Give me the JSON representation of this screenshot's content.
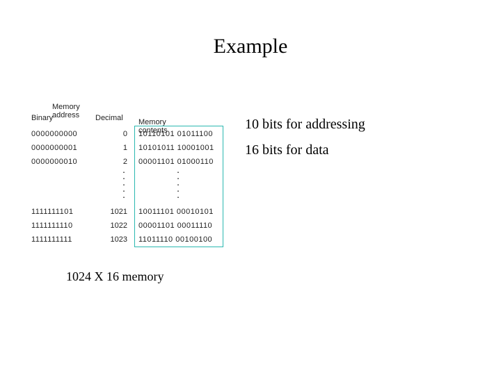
{
  "title": "Example",
  "figure": {
    "memAddrLabel": "Memory address",
    "binaryHead": "Binary",
    "decimalHead": "Decimal",
    "contentsHead": "Memory contents",
    "rows": [
      {
        "bin": "0000000000",
        "dec": "0",
        "cont": "10110101 01011100"
      },
      {
        "bin": "0000000001",
        "dec": "1",
        "cont": "10101011 10001001"
      },
      {
        "bin": "0000000010",
        "dec": "2",
        "cont": "00001101 01000110"
      },
      {
        "bin": "1111111101",
        "dec": "1021",
        "cont": "10011101 00010101"
      },
      {
        "bin": "1111111110",
        "dec": "1022",
        "cont": "00001101 00011110"
      },
      {
        "bin": "1111111111",
        "dec": "1023",
        "cont": "11011110 00100100"
      }
    ]
  },
  "caption": "1024 X 16 memory",
  "notes": {
    "line1": "10 bits for addressing",
    "line2": "16 bits for data"
  }
}
